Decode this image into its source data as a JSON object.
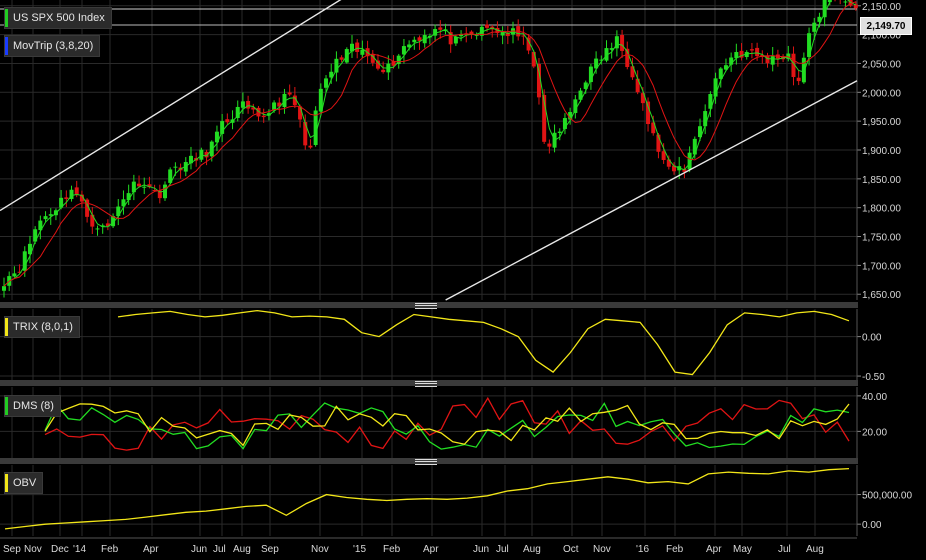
{
  "panels": {
    "price": {
      "legend_main": "US SPX 500 Index",
      "legend_mov": "MovTrip (3,8,20)",
      "last_price": "2,149.70"
    },
    "trix": {
      "legend": "TRIX (8,0,1)"
    },
    "dms": {
      "legend": "DMS (8)"
    },
    "obv": {
      "legend": "OBV"
    }
  },
  "colors": {
    "background": "#000000",
    "grid": "#2a2a2a",
    "up_candle": "#22dd22",
    "down_candle": "#e01414",
    "ma_green": "#22dd22",
    "ma_red": "#e01414",
    "yellow": "#f2e618",
    "trendline": "#e8e8e8",
    "legend_green": "#22cc22",
    "legend_blue": "#1a3cff",
    "legend_yellow": "#f2e618"
  },
  "chart_data": [
    {
      "type": "candlestick",
      "title": "US SPX 500 Index",
      "ylim": [
        1640,
        2160
      ],
      "y_ticks": [
        "2,150.00",
        "2,100.00",
        "2,050.00",
        "2,000.00",
        "1,950.00",
        "1,900.00",
        "1,850.00",
        "1,800.00",
        "1,750.00",
        "1,700.00",
        "1,650.00"
      ],
      "y_tick_values": [
        2150,
        2100,
        2050,
        2000,
        1950,
        1900,
        1850,
        1800,
        1750,
        1700,
        1650
      ],
      "x_labels": [
        "Sep",
        "Nov",
        "Dec",
        "'14",
        "Feb",
        "Apr",
        "Jun",
        "Jul",
        "Aug",
        "Sep",
        "Nov",
        "'15",
        "Feb",
        "Apr",
        "Jun",
        "Jul",
        "Aug",
        "Oct",
        "Nov",
        "'16",
        "Feb",
        "Apr",
        "May",
        "Jul",
        "Aug"
      ],
      "close_path": [
        [
          0,
          1675
        ],
        [
          0.02,
          1700
        ],
        [
          0.04,
          1775
        ],
        [
          0.06,
          1800
        ],
        [
          0.08,
          1835
        ],
        [
          0.1,
          1780
        ],
        [
          0.12,
          1760
        ],
        [
          0.14,
          1820
        ],
        [
          0.16,
          1850
        ],
        [
          0.18,
          1820
        ],
        [
          0.2,
          1870
        ],
        [
          0.22,
          1880
        ],
        [
          0.24,
          1900
        ],
        [
          0.26,
          1950
        ],
        [
          0.28,
          1975
        ],
        [
          0.3,
          1950
        ],
        [
          0.32,
          1985
        ],
        [
          0.34,
          1990
        ],
        [
          0.35,
          1930
        ],
        [
          0.36,
          1900
        ],
        [
          0.37,
          2000
        ],
        [
          0.39,
          2050
        ],
        [
          0.41,
          2075
        ],
        [
          0.43,
          2060
        ],
        [
          0.45,
          2040
        ],
        [
          0.47,
          2080
        ],
        [
          0.49,
          2100
        ],
        [
          0.51,
          2110
        ],
        [
          0.53,
          2085
        ],
        [
          0.55,
          2100
        ],
        [
          0.57,
          2110
        ],
        [
          0.6,
          2100
        ],
        [
          0.62,
          2075
        ],
        [
          0.635,
          1900
        ],
        [
          0.66,
          1950
        ],
        [
          0.68,
          2020
        ],
        [
          0.7,
          2060
        ],
        [
          0.72,
          2090
        ],
        [
          0.74,
          2030
        ],
        [
          0.76,
          1930
        ],
        [
          0.78,
          1860
        ],
        [
          0.8,
          1870
        ],
        [
          0.82,
          1960
        ],
        [
          0.84,
          2040
        ],
        [
          0.86,
          2070
        ],
        [
          0.88,
          2065
        ],
        [
          0.9,
          2055
        ],
        [
          0.92,
          2070
        ],
        [
          0.93,
          2010
        ],
        [
          0.95,
          2120
        ],
        [
          0.97,
          2170
        ],
        [
          0.985,
          2165
        ],
        [
          1,
          2150
        ]
      ],
      "series": [
        {
          "name": "MovTrip (3,8,20)",
          "role": "short_ma",
          "color": "#22dd22"
        },
        {
          "name": "MovTrip (3,8,20)",
          "role": "long_ma",
          "color": "#e01414"
        }
      ],
      "trendlines": [
        {
          "x": [
            0.0,
            0.56
          ],
          "y": [
            1795,
            2310
          ]
        },
        {
          "x": [
            0.52,
            1.0
          ],
          "y": [
            1640,
            2020
          ]
        }
      ]
    },
    {
      "type": "line",
      "title": "TRIX (8,0,1)",
      "ylim": [
        -0.55,
        0.35
      ],
      "y_ticks": [
        "0.00",
        "-0.50"
      ],
      "y_tick_values": [
        0,
        -0.5
      ],
      "series": [
        {
          "name": "TRIX (8,0,1)",
          "values": [
            0.25,
            0.28,
            0.3,
            0.32,
            0.28,
            0.25,
            0.27,
            0.3,
            0.33,
            0.3,
            0.25,
            0.26,
            0.25,
            0.22,
            0.05,
            0.0,
            0.15,
            0.28,
            0.25,
            0.22,
            0.2,
            0.18,
            0.1,
            0.0,
            -0.3,
            -0.45,
            -0.2,
            0.1,
            0.22,
            0.2,
            0.18,
            -0.1,
            -0.45,
            -0.48,
            -0.2,
            0.15,
            0.3,
            0.28,
            0.25,
            0.3,
            0.32,
            0.28,
            0.2
          ]
        }
      ]
    },
    {
      "type": "line",
      "title": "DMS (8)",
      "ylim": [
        5,
        45
      ],
      "y_ticks": [
        "40.00",
        "20.00"
      ],
      "y_tick_values": [
        40,
        20
      ]
    },
    {
      "type": "line",
      "title": "OBV",
      "ylim": [
        -200000,
        1000000
      ],
      "y_ticks": [
        "500,000.00",
        "0.00"
      ],
      "y_tick_values": [
        500000,
        0
      ],
      "series": [
        {
          "name": "OBV",
          "values": [
            -80000,
            -40000,
            0,
            20000,
            40000,
            60000,
            80000,
            120000,
            160000,
            200000,
            220000,
            260000,
            300000,
            320000,
            150000,
            350000,
            500000,
            450000,
            420000,
            400000,
            420000,
            430000,
            420000,
            440000,
            480000,
            560000,
            600000,
            680000,
            720000,
            760000,
            800000,
            760000,
            700000,
            720000,
            680000,
            850000,
            880000,
            860000,
            850000,
            900000,
            880000,
            920000,
            940000
          ]
        }
      ]
    }
  ]
}
